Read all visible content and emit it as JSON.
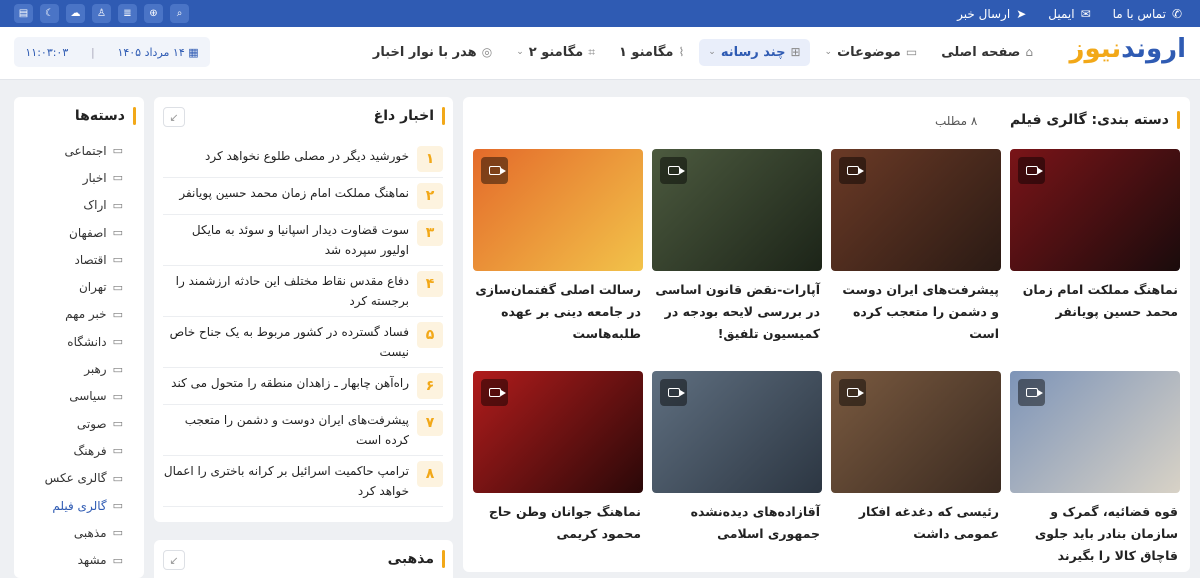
{
  "topbar": {
    "contact": "تماس با ما",
    "email": "ایمیل",
    "send_news": "ارسال خبر",
    "icons": [
      "search-icon",
      "globe-icon",
      "database-icon",
      "user-icon",
      "cloud-icon",
      "moon-icon",
      "archive-icon"
    ]
  },
  "logo": {
    "part1": "اروند",
    "part2": "نیوز"
  },
  "nav": {
    "home": "صفحه اصلی",
    "topics": "موضوعات",
    "multimedia": "چند رسانه",
    "megamenu1": "مگامنو ۱",
    "megamenu2": "مگامنو ۲",
    "header_ticker": "هدر با نوار اخبار"
  },
  "datetime": {
    "time": "۱۱:۰۳:۰۳",
    "date": "۱۴ مرداد ۱۴۰۵"
  },
  "categories": {
    "title": "دسته‌ها",
    "items": [
      "اجتماعی",
      "اخبار",
      "اراک",
      "اصفهان",
      "اقتصاد",
      "تهران",
      "خبر مهم",
      "دانشگاه",
      "رهبر",
      "سیاسی",
      "صوتی",
      "فرهنگ",
      "گالری عکس",
      "گالری فیلم",
      "مذهبی",
      "مشهد"
    ],
    "active": "گالری فیلم"
  },
  "hot": {
    "title": "اخبار داغ",
    "items": [
      {
        "n": "۱",
        "t": "خورشید دیگر در مصلی طلوع نخواهد کرد"
      },
      {
        "n": "۲",
        "t": "نماهنگ مملکت امام زمان محمد حسین پویانفر"
      },
      {
        "n": "۳",
        "t": "سوت قضاوت دیدار اسپانیا و سوئد به مایکل اولیور سپرده شد"
      },
      {
        "n": "۴",
        "t": "دفاع مقدس نقاط مختلف این حادثه ارزشمند را برجسته کرد"
      },
      {
        "n": "۵",
        "t": "فساد گسترده در کشور مربوط به یک جناح خاص نیست"
      },
      {
        "n": "۶",
        "t": "راه‌آهن چابهار ـ زاهدان منطقه را متحول می کند"
      },
      {
        "n": "۷",
        "t": "پیشرفت‌های ایران دوست و دشمن را متعجب کرده است"
      },
      {
        "n": "۸",
        "t": "ترامپ حاکمیت اسرائیل بر کرانه باختری را اعمال خواهد کرد"
      }
    ]
  },
  "religious": {
    "title": "مذهبی"
  },
  "main": {
    "title": "دسته بندی: گالری فیلم",
    "count": "۸ مطلب",
    "cards": [
      {
        "t": "نماهنگ مملکت امام زمان محمد حسین پویانفر",
        "c1": "#7a1418",
        "c2": "#1a0b0c"
      },
      {
        "t": "پیشرفت‌های ایران دوست و دشمن را متعجب کرده است",
        "c1": "#6b3a26",
        "c2": "#2a1a14"
      },
      {
        "t": "آپارات-نقض قانون اساسی در بررسی لایحه بودجه در کمیسیون تلفیق!",
        "c1": "#4c5a3f",
        "c2": "#1c2418"
      },
      {
        "t": "رسالت اصلی گفتمان‌سازی در جامعه دینی بر عهده طلبه‌هاست",
        "c1": "#e46a2a",
        "c2": "#f2c34a"
      },
      {
        "t": "قوه قضائیه، گمرک و سازمان بنادر باید جلوی قاچاق کالا را بگیرند",
        "c1": "#7d94b8",
        "c2": "#d8d2c6"
      },
      {
        "t": "رئیسی که دغدغه افکار عمومی داشت",
        "c1": "#7a5a40",
        "c2": "#3a2a20"
      },
      {
        "t": "آقازاده‌های دیده‌نشده جمهوری اسلامی",
        "c1": "#5f6f80",
        "c2": "#2c3642"
      },
      {
        "t": "نماهنگ جوانان وطن حاج محمود کریمی",
        "c1": "#b11c1c",
        "c2": "#2a0808"
      }
    ]
  }
}
